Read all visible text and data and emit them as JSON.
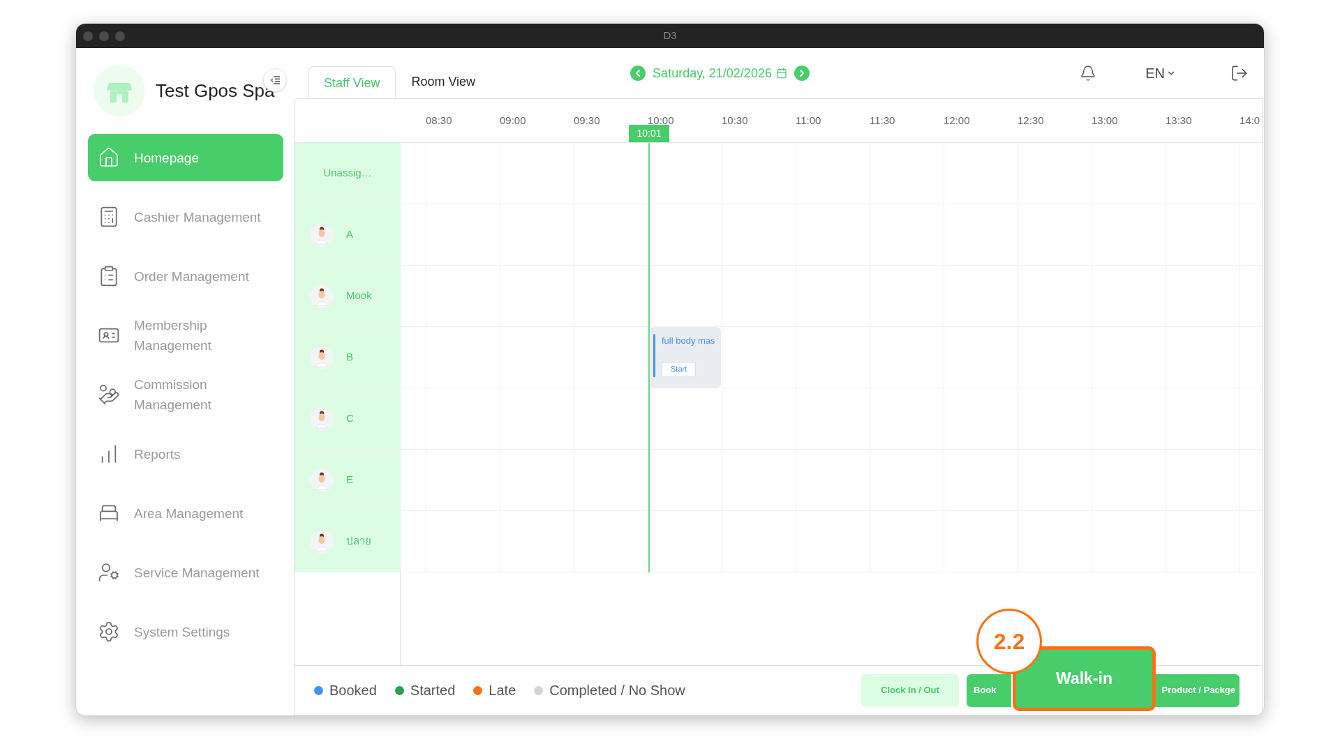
{
  "window": {
    "title": "D3"
  },
  "sidebar": {
    "brand": "Test Gpos Spa",
    "items": [
      {
        "label": "Homepage",
        "selected": true
      },
      {
        "label": "Cashier Management",
        "selected": false
      },
      {
        "label": "Order Management",
        "selected": false
      },
      {
        "label": "Membership Management",
        "selected": false
      },
      {
        "label": "Commission Management",
        "selected": false
      },
      {
        "label": "Reports",
        "selected": false
      },
      {
        "label": "Area Management",
        "selected": false
      },
      {
        "label": "Service Management",
        "selected": false
      },
      {
        "label": "System Settings",
        "selected": false
      }
    ]
  },
  "tabs": [
    {
      "label": "Staff View",
      "selected": true
    },
    {
      "label": "Room View",
      "selected": false
    }
  ],
  "date": "Saturday, 21/02/2026",
  "language": "EN",
  "schedule": {
    "times": [
      "08:30",
      "09:00",
      "09:30",
      "10:00",
      "10:30",
      "11:00",
      "11:30",
      "12:00",
      "12:30",
      "13:00",
      "13:30",
      "14:0"
    ],
    "now": "10:01",
    "staff": [
      {
        "name": "Unassig…",
        "kind": "unassigned"
      },
      {
        "name": "A",
        "kind": "staff"
      },
      {
        "name": "Mook",
        "kind": "staff"
      },
      {
        "name": "B",
        "kind": "staff",
        "bookings": [
          {
            "title": "full body mas",
            "action": "Start",
            "color": "#4a8fe6"
          }
        ]
      },
      {
        "name": "C",
        "kind": "staff"
      },
      {
        "name": "E",
        "kind": "staff"
      },
      {
        "name": "ปลาย",
        "kind": "staff"
      }
    ]
  },
  "legend": [
    {
      "label": "Booked",
      "color": "#4a8fe6"
    },
    {
      "label": "Started",
      "color": "#2e9e4f"
    },
    {
      "label": "Late",
      "color": "#f97316"
    },
    {
      "label": "Completed / No Show",
      "color": "#d1d5db"
    }
  ],
  "buttons": [
    {
      "label": "Clock In / Out",
      "kind": "light"
    },
    {
      "label": "Book",
      "kind": "solid"
    },
    {
      "label": "Product / Packge",
      "kind": "solid"
    }
  ],
  "highlight": {
    "label": "Walk-in",
    "step": "2.2"
  }
}
